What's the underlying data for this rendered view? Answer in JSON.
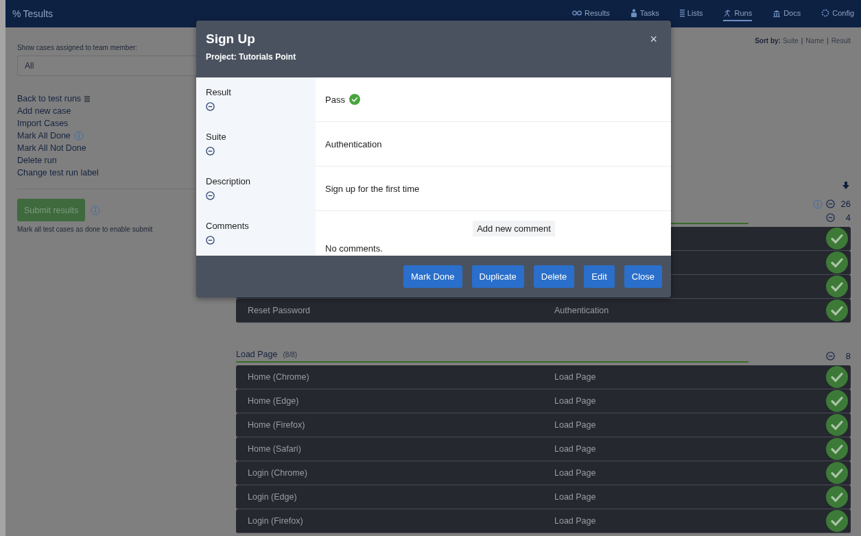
{
  "app": {
    "logo_mark": "%",
    "logo_text": "Tesults"
  },
  "nav": [
    {
      "label": "Results",
      "selected": false
    },
    {
      "label": "Tasks",
      "selected": false
    },
    {
      "label": "Lists",
      "selected": false
    },
    {
      "label": "Runs",
      "selected": true
    },
    {
      "label": "Docs",
      "selected": false
    },
    {
      "label": "Config",
      "selected": false
    }
  ],
  "sidebar": {
    "filter_label": "Show cases assigned to team member:",
    "filter_value": "All",
    "links": [
      "Back to test runs",
      "Add new case",
      "Import Cases",
      "Mark All Done",
      "Mark All Not Done",
      "Delete run",
      "Change test run label"
    ],
    "submit": {
      "label": "Submit results",
      "disabled": true
    },
    "submit_hint": "Mark all test cases as done to enable submit"
  },
  "main": {
    "sort_label": "Sort by:",
    "sort_items": [
      {
        "kind": "option",
        "label": "Suite"
      },
      {
        "kind": "separator",
        "label": "|"
      },
      {
        "kind": "option",
        "label": "Name"
      },
      {
        "kind": "separator",
        "label": "|"
      },
      {
        "kind": "option",
        "label": "Result"
      }
    ],
    "total": "26",
    "groups": [
      {
        "total": "4",
        "rows": [
          {
            "passed": true
          },
          {
            "passed": true
          },
          {
            "passed": true
          },
          {
            "name": "Reset Password",
            "suite": "Authentication",
            "passed": true
          }
        ]
      },
      {
        "title": "Load Page",
        "count": "(8/8)",
        "total": "8",
        "rows": [
          {
            "name": "Home (Chrome)",
            "suite": "Load Page",
            "passed": true
          },
          {
            "name": "Home (Edge)",
            "suite": "Load Page",
            "passed": true
          },
          {
            "name": "Home (Firefox)",
            "suite": "Load Page",
            "passed": true
          },
          {
            "name": "Home (Safari)",
            "suite": "Load Page",
            "passed": true
          },
          {
            "name": "Login (Chrome)",
            "suite": "Load Page",
            "passed": true
          },
          {
            "name": "Login (Edge)",
            "suite": "Load Page",
            "passed": true
          },
          {
            "name": "Login (Firefox)",
            "suite": "Load Page",
            "passed": true
          }
        ]
      }
    ]
  },
  "modal": {
    "title": "Sign Up",
    "subtitle": "Project: Tutorials Point",
    "close": "×",
    "fields": [
      {
        "label": "Result",
        "kind": "result",
        "value": "Pass",
        "passed": true
      },
      {
        "label": "Suite",
        "kind": "text",
        "value": "Authentication"
      },
      {
        "label": "Description",
        "kind": "text",
        "value": "Sign up for the first time"
      },
      {
        "label": "Comments",
        "kind": "comments",
        "action": "Add new comment",
        "value": "No comments."
      }
    ],
    "buttons": [
      "Mark Done",
      "Duplicate",
      "Delete",
      "Edit",
      "Close"
    ]
  }
}
